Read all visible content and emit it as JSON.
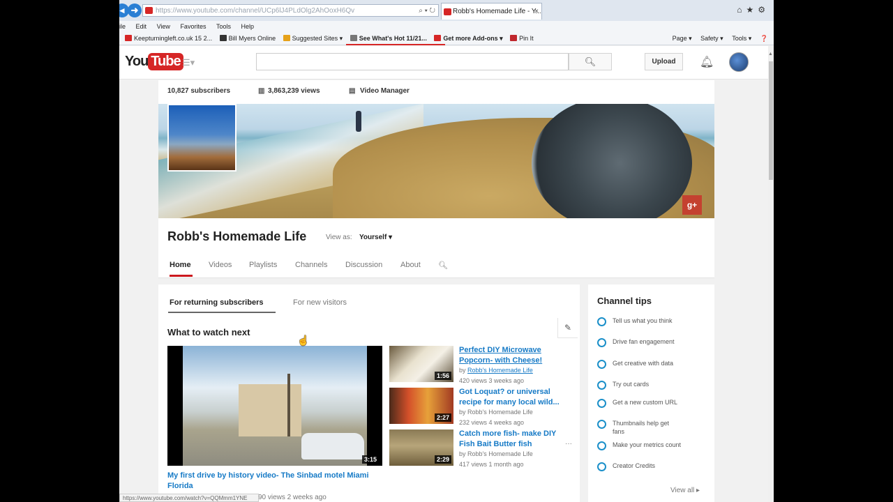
{
  "browser": {
    "address": "https://www.youtube.com/channel/UCp6lJ4PLdOlg2AhOoxH6Qv",
    "tab_title": "Robb's Homemade Life - Y...",
    "tab_close": "×",
    "menu": [
      "ile",
      "Edit",
      "View",
      "Favorites",
      "Tools",
      "Help"
    ],
    "favorites": [
      "Keepturningleft.co.uk 15 2...",
      "Bill Myers Online",
      "Suggested Sites ▾",
      "See What's Hot 11/21...",
      "Get more Add-ons ▾",
      "Pin It"
    ],
    "command_bar": [
      "Page ▾",
      "Safety ▾",
      "Tools ▾"
    ],
    "status_url": "https://www.youtube.com/watch?v=QQMmm1YNE"
  },
  "header": {
    "logo_you": "You",
    "logo_tube": "Tube",
    "search_placeholder": "",
    "upload_label": "Upload"
  },
  "stats": {
    "subscribers": "10,827 subscribers",
    "views": "3,863,239 views",
    "video_manager": "Video Manager"
  },
  "channel": {
    "name": "Robb's Homemade Life",
    "view_as_label": "View as:",
    "view_as_value": "Yourself ▾",
    "tabs": [
      "Home",
      "Videos",
      "Playlists",
      "Channels",
      "Discussion",
      "About"
    ]
  },
  "main": {
    "subtabs": [
      "For returning subscribers",
      "For new visitors"
    ],
    "section_title": "What to watch next",
    "featured": {
      "duration": "3:15",
      "title": "My first drive by history video- The Sinbad motel Miami Florida",
      "meta": "90 views  2 weeks ago"
    },
    "videos": [
      {
        "title": "Perfect DIY Microwave Popcorn- with Cheese!",
        "by_label": "by",
        "channel": "Robb's Homemade Life",
        "meta": "420 views   3 weeks ago",
        "duration": "1:56"
      },
      {
        "title": "Got Loquat? or universal recipe for many local wild...",
        "by_label": "by",
        "channel": "Robb's Homemade Life",
        "meta": "232 views   4 weeks ago",
        "duration": "2:27"
      },
      {
        "title": "Catch more fish- make DIY Fish Bait Butter fish",
        "by_label": "by",
        "channel": "Robb's Homemade Life",
        "meta": "417 views   1 month ago",
        "duration": "2:29"
      }
    ],
    "more": "···"
  },
  "side": {
    "title": "Channel tips",
    "tips": [
      "Tell us what you think",
      "Drive fan engagement",
      "Get creative with data",
      "Try out cards",
      "Get a new custom URL",
      "Thumbnails help get fans",
      "Make your metrics count",
      "Creator Credits"
    ],
    "view_all": "View all ▸"
  },
  "colors": {
    "brand_red": "#cc181e",
    "link_blue": "#167ac6",
    "tip_ring": "#1a8fc9"
  }
}
